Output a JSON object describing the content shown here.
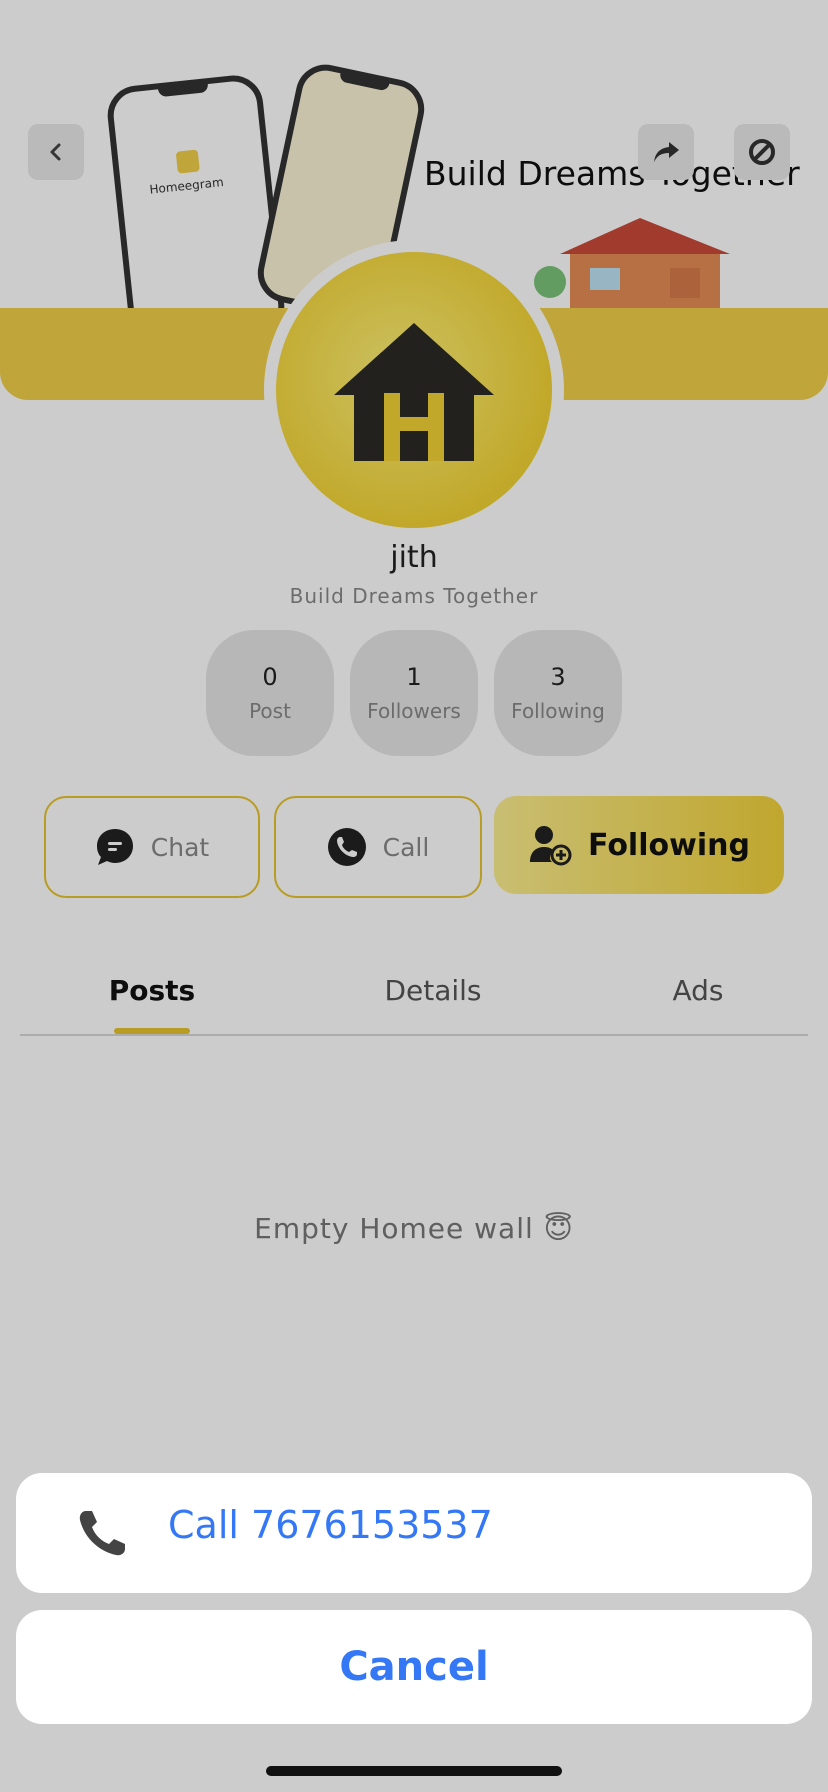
{
  "banner": {
    "title": "Build Dreams Together",
    "phone_app_name": "Homeegram",
    "strip_color": "#f0cf4a"
  },
  "top_bar": {
    "back_icon": "chevron-left-icon",
    "share_icon": "share-forward-icon",
    "block_icon": "block-icon"
  },
  "profile": {
    "name": "jith",
    "tagline": "Build Dreams Together",
    "avatar_icon": "home-logo-icon"
  },
  "stats": [
    {
      "value": "0",
      "label": "Post"
    },
    {
      "value": "1",
      "label": "Followers"
    },
    {
      "value": "3",
      "label": "Following"
    }
  ],
  "actions": {
    "chat_label": "Chat",
    "call_label": "Call",
    "follow_label": "Following"
  },
  "tabs": [
    {
      "label": "Posts",
      "active": true
    },
    {
      "label": "Details",
      "active": false
    },
    {
      "label": "Ads",
      "active": false
    }
  ],
  "empty_state": "Empty Homee wall 😇",
  "action_sheet": {
    "call_option": "Call 7676153537",
    "cancel": "Cancel",
    "link_color": "#3478f6"
  },
  "colors": {
    "accent": "#f0cf4a",
    "accent_dark": "#e8c42e"
  }
}
